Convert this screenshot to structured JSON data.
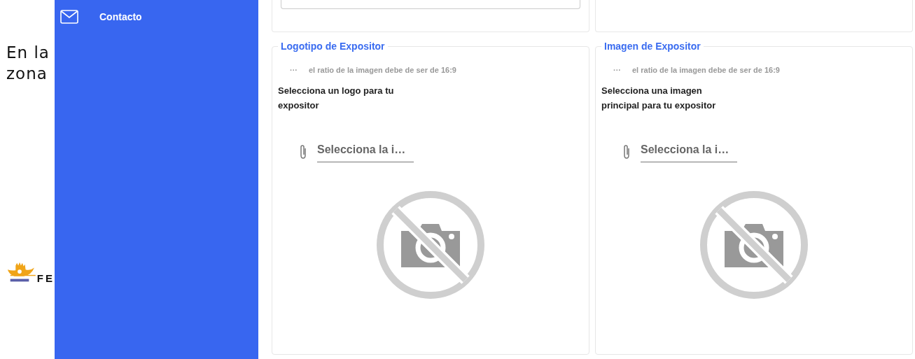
{
  "background_text": [
    "En la",
    "zona"
  ],
  "logo": {
    "text": "FE"
  },
  "sidebar": {
    "items": [
      {
        "label": "Contacto"
      }
    ]
  },
  "uploads": [
    {
      "title": "Logotipo de Expositor",
      "hint_icon": "···",
      "hint": "el ratio de la imagen debe de ser de 16:9",
      "description": "Selecciona un logo para tu expositor",
      "file_field": {
        "placeholder": "Selecciona la i…"
      }
    },
    {
      "title": "Imagen de Expositor",
      "hint_icon": "···",
      "hint": "el ratio de la imagen debe de ser de 16:9",
      "description": "Selecciona una imagen principal para tu expositor",
      "file_field": {
        "placeholder": "Selecciona la i…"
      }
    }
  ]
}
